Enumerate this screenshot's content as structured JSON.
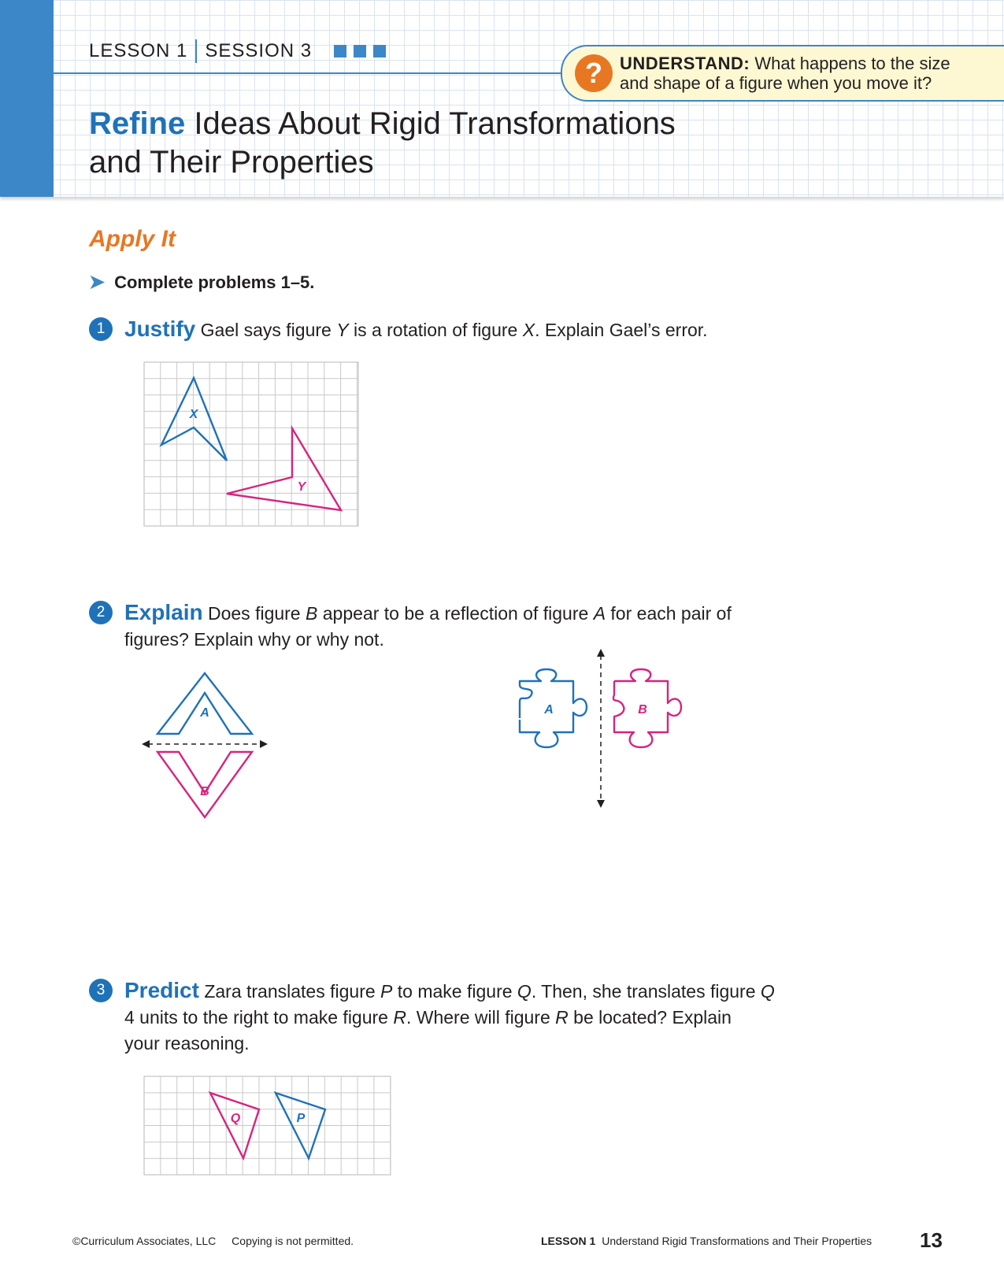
{
  "header": {
    "lesson": "LESSON 1",
    "session": "SESSION 3",
    "understand_label": "UNDERSTAND:",
    "understand_text_1": "What happens to the size",
    "understand_text_2": "and shape of a figure when you move it?",
    "question_icon": "?",
    "title_keyword": "Refine",
    "title_line1_rest": " Ideas About Rigid Transformations",
    "title_line2": "and Their Properties",
    "colors": {
      "brand_blue": "#3b87c8",
      "accent_orange": "#e87722",
      "callout_bg": "#fdf8d2"
    }
  },
  "apply": {
    "heading": "Apply It",
    "instruction": "Complete problems 1–5."
  },
  "problems": [
    {
      "number": "1",
      "keyword": "Justify",
      "t1": " Gael says figure ",
      "v1": "Y",
      "t2": " is a rotation of figure ",
      "v2": "X",
      "t3": ". Explain Gael’s error.",
      "labels": [
        "X",
        "Y"
      ]
    },
    {
      "number": "2",
      "keyword": "Explain",
      "t1": " Does figure ",
      "v1": "B",
      "t2": " appear to be a reflection of figure ",
      "v2": "A",
      "t3": " for each pair of",
      "line2": "figures? Explain why or why not.",
      "labels": [
        "A",
        "B",
        "A",
        "B"
      ]
    },
    {
      "number": "3",
      "keyword": "Predict",
      "t1": " Zara translates figure ",
      "v1": "P",
      "t2": " to make figure ",
      "v2": "Q",
      "t3": ". Then, she translates figure ",
      "v3": "Q",
      "line2a": "4 units to the right to make figure ",
      "v4": "R",
      "line2b": ". Where will figure ",
      "v5": "R",
      "line2c": " be located? Explain",
      "line3": "your reasoning.",
      "labels": [
        "Q",
        "P"
      ]
    }
  ],
  "figure_colors": {
    "blue": "#1f72b8",
    "magenta": "#d6247f"
  },
  "footer": {
    "copyright": "©Curriculum Associates, LLC",
    "notice": "Copying is not permitted.",
    "lesson": "LESSON 1",
    "lesson_title": "Understand Rigid Transformations and Their Properties",
    "page": "13"
  }
}
